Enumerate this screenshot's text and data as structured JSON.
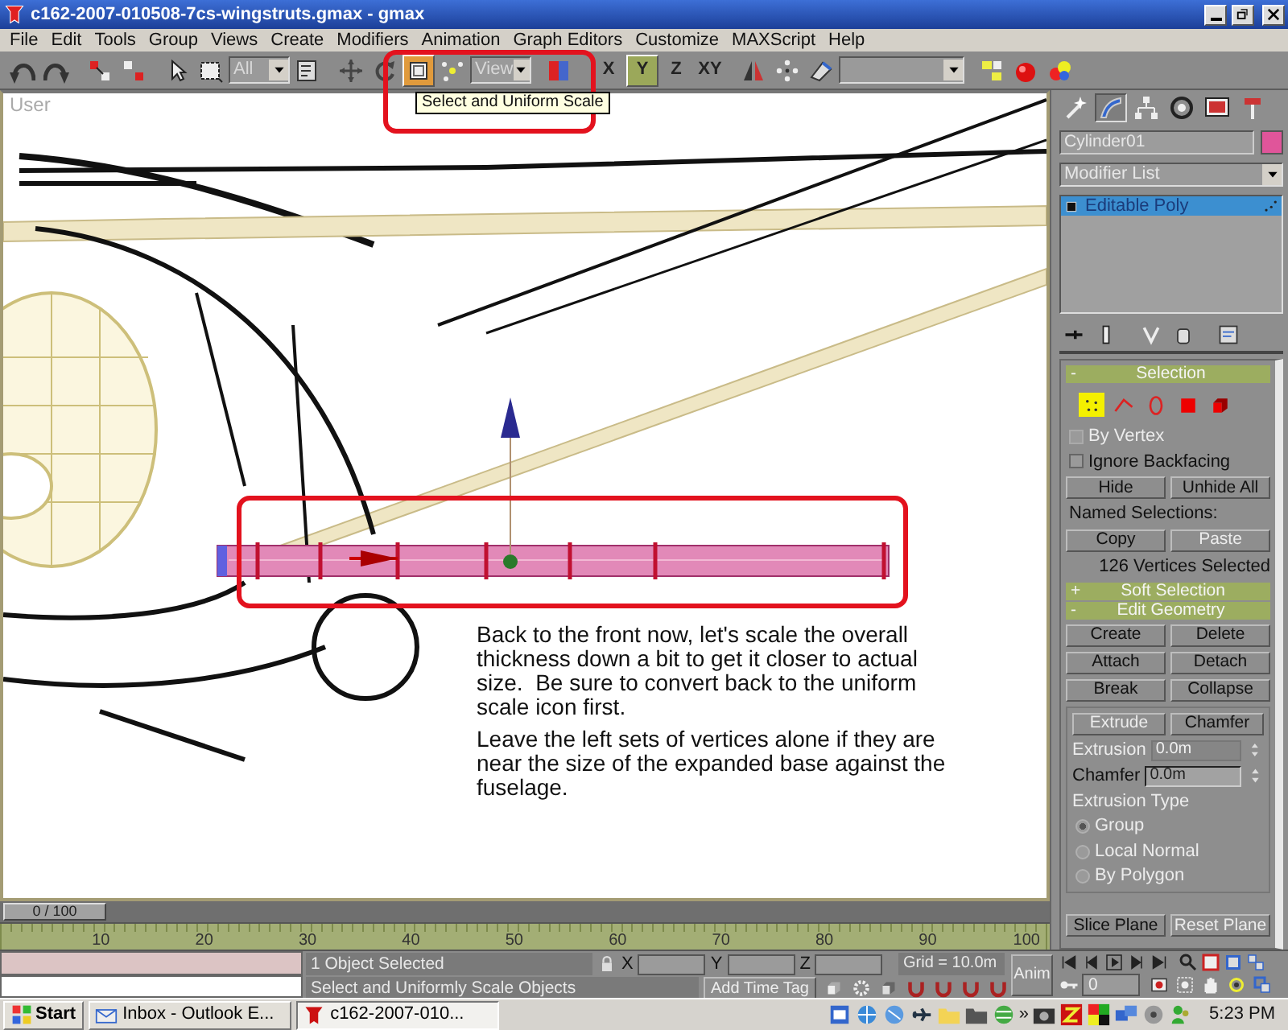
{
  "window": {
    "title": "c162-2007-010508-7cs-wingstruts.gmax - gmax"
  },
  "menu": [
    "File",
    "Edit",
    "Tools",
    "Group",
    "Views",
    "Create",
    "Modifiers",
    "Animation",
    "Graph Editors",
    "Customize",
    "MAXScript",
    "Help"
  ],
  "toolbar": [
    {
      "kind": "undo",
      "selected": false
    },
    {
      "kind": "redo",
      "selected": false
    },
    {
      "kind": "link",
      "selected": false
    },
    {
      "kind": "unlink",
      "selected": false
    },
    {
      "kind": "select",
      "selected": false
    },
    {
      "kind": "region",
      "selected": false
    },
    {
      "kind": "dropdown",
      "value": "All"
    },
    {
      "kind": "select-name",
      "selected": false
    },
    {
      "kind": "move",
      "selected": false
    },
    {
      "kind": "rotate",
      "selected": false
    },
    {
      "kind": "scale",
      "selected": true
    },
    {
      "kind": "pivot",
      "selected": false
    },
    {
      "kind": "dropdown",
      "value": "View"
    },
    {
      "kind": "manipulate",
      "selected": false
    },
    {
      "kind": "axis",
      "label": "X",
      "selected": false
    },
    {
      "kind": "axis",
      "label": "Y",
      "selected": true
    },
    {
      "kind": "axis",
      "label": "Z",
      "selected": false
    },
    {
      "kind": "axis",
      "label": "XY",
      "selected": false
    },
    {
      "kind": "mirror",
      "selected": false
    },
    {
      "kind": "array",
      "selected": false
    },
    {
      "kind": "align",
      "selected": false
    },
    {
      "kind": "dropdown"
    },
    {
      "kind": "layers",
      "selected": false
    },
    {
      "kind": "render",
      "selected": false
    },
    {
      "kind": "material",
      "selected": false
    }
  ],
  "tooltip": "Select and Uniform Scale",
  "viewport": {
    "label": "User",
    "note": [
      "Back to the front now, let's scale the overall thickness down a bit to get it closer to actual size.  Be sure to convert back to the uniform scale icon first.",
      "Leave the left sets of vertices alone if they are near the size of the expanded base against the fuselage."
    ]
  },
  "command_panel": {
    "tabs": [
      {
        "kind": "create",
        "selected": false
      },
      {
        "kind": "modify",
        "selected": true
      },
      {
        "kind": "hierarchy",
        "selected": false
      },
      {
        "kind": "motion",
        "selected": false
      },
      {
        "kind": "display",
        "selected": false
      },
      {
        "kind": "utilities",
        "selected": false
      }
    ],
    "object_name": "Cylinder01",
    "modifier_list": "Modifier List",
    "stack": [
      {
        "label": "Editable Poly",
        "selected": true
      }
    ],
    "selection": {
      "title": "Selection",
      "toggle": "-",
      "levels": [
        {
          "kind": "vertex",
          "selected": true
        },
        {
          "kind": "edge",
          "selected": false
        },
        {
          "kind": "border",
          "selected": false
        },
        {
          "kind": "polygon",
          "selected": false
        },
        {
          "kind": "element",
          "selected": false
        }
      ],
      "options": [
        {
          "label": "By Vertex",
          "checked": false,
          "disabled": true
        },
        {
          "label": "Ignore Backfacing",
          "checked": false,
          "disabled": false
        }
      ],
      "buttons": [
        {
          "label": "Hide",
          "disabled": false
        },
        {
          "label": "Unhide All",
          "disabled": false
        }
      ],
      "named_label": "Named Selections:",
      "named_buttons": [
        {
          "label": "Copy",
          "disabled": false
        },
        {
          "label": "Paste",
          "disabled": true
        }
      ],
      "info": "126 Vertices Selected"
    },
    "soft_selection": {
      "title": "Soft Selection",
      "toggle": "+"
    },
    "edit_geometry": {
      "title": "Edit Geometry",
      "toggle": "-",
      "buttons": [
        {
          "label": "Create",
          "disabled": false
        },
        {
          "label": "Delete",
          "disabled": false
        },
        {
          "label": "Attach",
          "disabled": false
        },
        {
          "label": "Detach",
          "disabled": false
        },
        {
          "label": "Break",
          "disabled": false
        },
        {
          "label": "Collapse",
          "disabled": false
        }
      ],
      "extrude_buttons": [
        {
          "label": "Extrude",
          "disabled": true
        },
        {
          "label": "Chamfer",
          "disabled": false
        }
      ],
      "fields": [
        {
          "label": "Extrusion",
          "value": "0.0m",
          "disabled": true
        },
        {
          "label": "Chamfer",
          "value": "0.0m",
          "disabled": false
        }
      ],
      "extrusion_type": {
        "label": "Extrusion Type",
        "disabled": true,
        "options": [
          {
            "label": "Group",
            "selected": true,
            "disabled": true
          },
          {
            "label": "Local Normal",
            "selected": false,
            "disabled": true
          },
          {
            "label": "By Polygon",
            "selected": false,
            "disabled": true
          }
        ]
      },
      "plane_buttons": [
        {
          "label": "Slice Plane",
          "disabled": false
        },
        {
          "label": "Reset Plane",
          "disabled": true
        }
      ]
    }
  },
  "timeline": {
    "slider": {
      "label": "0 / 100",
      "level": 0
    },
    "ticks": [
      "10",
      "20",
      "30",
      "40",
      "50",
      "60",
      "70",
      "80",
      "90",
      "100"
    ]
  },
  "status": {
    "selection": "1 Object Selected",
    "prompt": "Select and Uniformly Scale Objects",
    "coords": [
      "X",
      "Y",
      "Z"
    ],
    "grid": "Grid = 10.0m",
    "time_tag": "Add Time Tag",
    "anim": "Anim",
    "frame": "0"
  },
  "taskbar": {
    "start": "Start",
    "tasks": [
      {
        "label": "Inbox - Outlook E...",
        "kind": "mail",
        "selected": false
      },
      {
        "label": "c162-2007-010...",
        "kind": "gmax",
        "selected": true
      }
    ],
    "chevron": "»",
    "clock": "5:23 PM"
  }
}
